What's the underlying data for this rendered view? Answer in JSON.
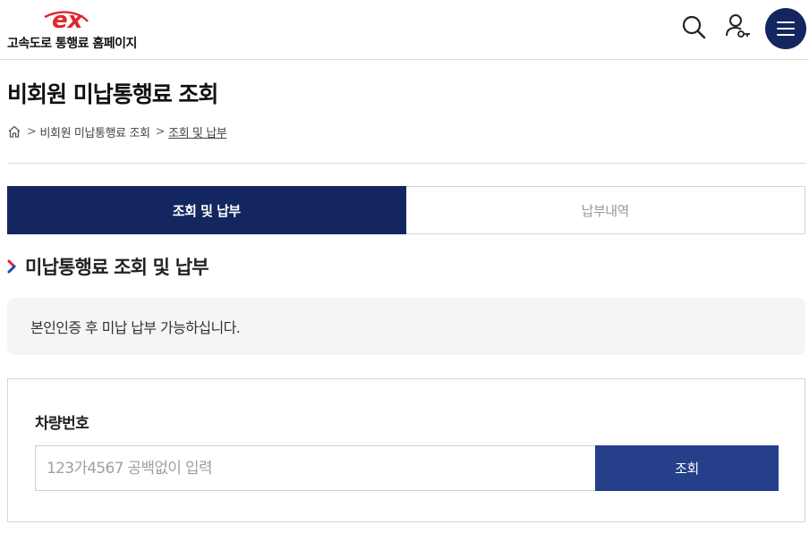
{
  "header": {
    "site_name": "고속도로 통행료 홈페이지",
    "logo_icon": "ex-logo-icon",
    "icons": [
      "search-icon",
      "user-key-icon",
      "hamburger-menu-icon"
    ],
    "brand_color": "#14265f",
    "logo_color": "#e0262d"
  },
  "page": {
    "title": "비회원 미납통행료 조회"
  },
  "breadcrumb": {
    "home_icon": "home-icon",
    "items": [
      "비회원 미납통행료 조회",
      "조회 및 납부"
    ]
  },
  "tabs": [
    {
      "label": "조회 및 납부",
      "active": true
    },
    {
      "label": "납부내역",
      "active": false
    }
  ],
  "section": {
    "title": "미납통행료 조회 및 납부",
    "icon": "chevron-right-icon"
  },
  "notice": {
    "text": "본인인증 후 미납 납부 가능하십니다."
  },
  "form": {
    "label": "차량번호",
    "placeholder": "123가4567 공백없이 입력",
    "value": "",
    "button_label": "조회",
    "button_color": "#253f8a"
  }
}
